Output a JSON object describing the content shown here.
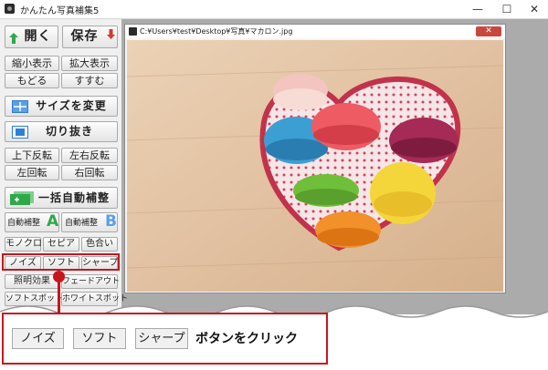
{
  "window": {
    "title": "かんたん写真補集5",
    "minimize_glyph": "—",
    "maximize_glyph": "☐",
    "close_glyph": "✕"
  },
  "toolbar": {
    "open_label": "開く",
    "save_label": "保存",
    "zoom_out_label": "縮小表示",
    "zoom_in_label": "拡大表示",
    "undo_label": "もどる",
    "redo_label": "すすむ",
    "resize_label": "サイズを変更",
    "crop_label": "切り抜き",
    "flip_vertical_label": "上下反転",
    "flip_horizontal_label": "左右反転",
    "rotate_left_label": "左回転",
    "rotate_right_label": "右回転",
    "auto_all_label": "一括自動補整",
    "auto_a_label": "自動補整",
    "auto_a_letter": "A",
    "auto_b_label": "自動補整",
    "auto_b_letter": "B",
    "mono_label": "モノクロ",
    "sepia_label": "セピア",
    "hue_label": "色合い",
    "noise_label": "ノイズ",
    "soft_label": "ソフト",
    "sharp_label": "シャープ",
    "lighting_label": "照明効果",
    "fade_out_label": "フェードアウト",
    "soft_spot_label": "ソフトスポット",
    "white_spot_label": "ホワイトスポット"
  },
  "image_window": {
    "path": "C:¥Users¥test¥Desktop¥写真¥マカロン.jpg",
    "close_glyph": "✕"
  },
  "callout": {
    "noise_label": "ノイズ",
    "soft_label": "ソフト",
    "sharp_label": "シャープ",
    "instruction": "ボタンをクリック"
  },
  "colors": {
    "highlight": "#c8161d",
    "child_close": "#c9473d",
    "workspace": "#ababab",
    "icon_accent_green": "#2fa84a",
    "icon_accent_blue": "#2f7fd6"
  }
}
